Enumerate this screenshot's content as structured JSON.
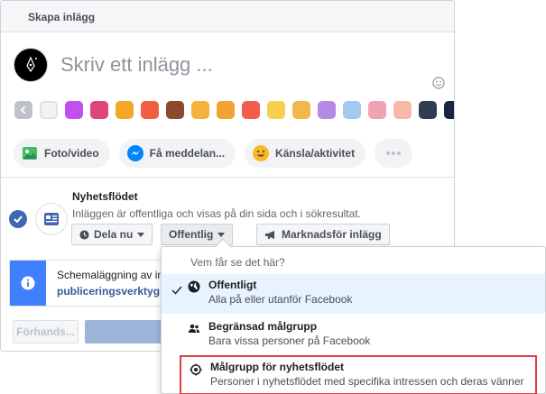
{
  "header": {
    "title": "Skapa inlägg"
  },
  "composer": {
    "placeholder": "Skriv ett inlägg ..."
  },
  "swatches": [
    "#f0f2f5",
    "#c150f0",
    "#e0457a",
    "#f5a623",
    "#f06040",
    "#8b4a2c",
    "#f5b13d",
    "#f2a233",
    "#f25c4b",
    "#f7cf4e",
    "#f2b94a",
    "#b48ae6",
    "#a3c9f0",
    "#f0a3b5",
    "#f7b8a8",
    "#2c3e50",
    "#1c2540"
  ],
  "actions": [
    {
      "label": "Foto/video",
      "icon": "photo-icon"
    },
    {
      "label": "Få meddelan...",
      "icon": "messenger-icon"
    },
    {
      "label": "Känsla/aktivitet",
      "icon": "smiley-icon"
    }
  ],
  "feed": {
    "title": "Nyhetsflödet",
    "description": "Inläggen är offentliga och visas på din sida och i sökresultat.",
    "share_now": "Dela nu",
    "audience": "Offentlig",
    "promote": "Marknadsför inlägg"
  },
  "schedule": {
    "line1": "Schemaläggning av in",
    "line2": "publiceringsverktyg"
  },
  "footer": {
    "preview": "Förhands..."
  },
  "dropdown": {
    "title": "Vem får se det här?",
    "options": [
      {
        "title": "Offentligt",
        "description": "Alla på eller utanför Facebook",
        "selected": true
      },
      {
        "title": "Begränsad målgrupp",
        "description": "Bara vissa personer på Facebook",
        "selected": false
      },
      {
        "title": "Målgrupp för nyhetsflödet",
        "description": "Personer i nyhetsflödet med specifika intressen och deras vänner",
        "selected": false,
        "highlighted": true
      }
    ]
  },
  "colors": {
    "accent": "#4267b2",
    "highlight_border": "#e0393e",
    "selected_bg": "#e7f3ff"
  }
}
